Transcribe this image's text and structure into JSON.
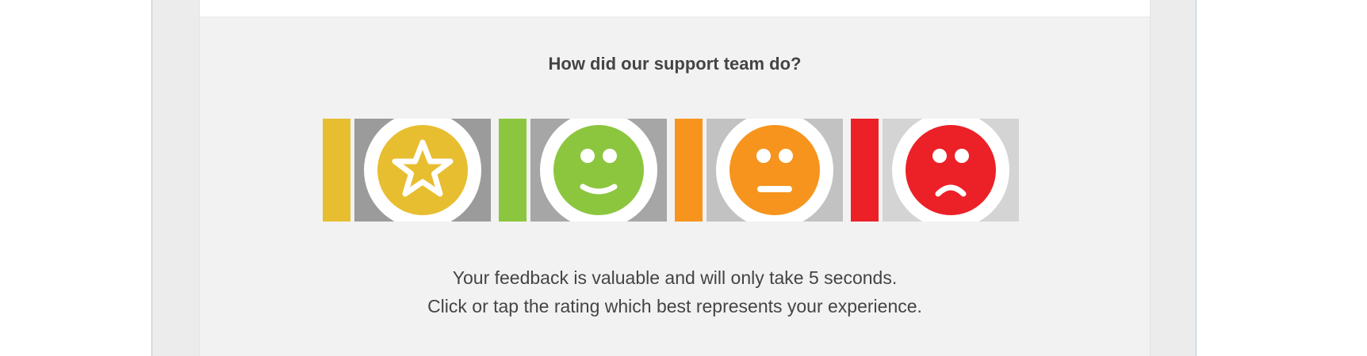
{
  "survey": {
    "question": "How did our support team do?",
    "line1": "Your feedback is valuable and will only take 5 seconds.",
    "line2": "Click or tap the rating which best represents your experience."
  },
  "ratings": [
    {
      "icon": "star-icon",
      "bar_color": "#e8be31",
      "face_color": "#e8be31",
      "tile_bg": "#9c9b9c"
    },
    {
      "icon": "smiley-happy-icon",
      "bar_color": "#8cc63f",
      "face_color": "#8cc63f",
      "tile_bg": "#a6a6a6"
    },
    {
      "icon": "smiley-neutral-icon",
      "bar_color": "#f7941d",
      "face_color": "#f7941d",
      "tile_bg": "#c2c2c2"
    },
    {
      "icon": "smiley-sad-icon",
      "bar_color": "#ec2027",
      "face_color": "#ec2027",
      "tile_bg": "#d4d4d4"
    }
  ]
}
